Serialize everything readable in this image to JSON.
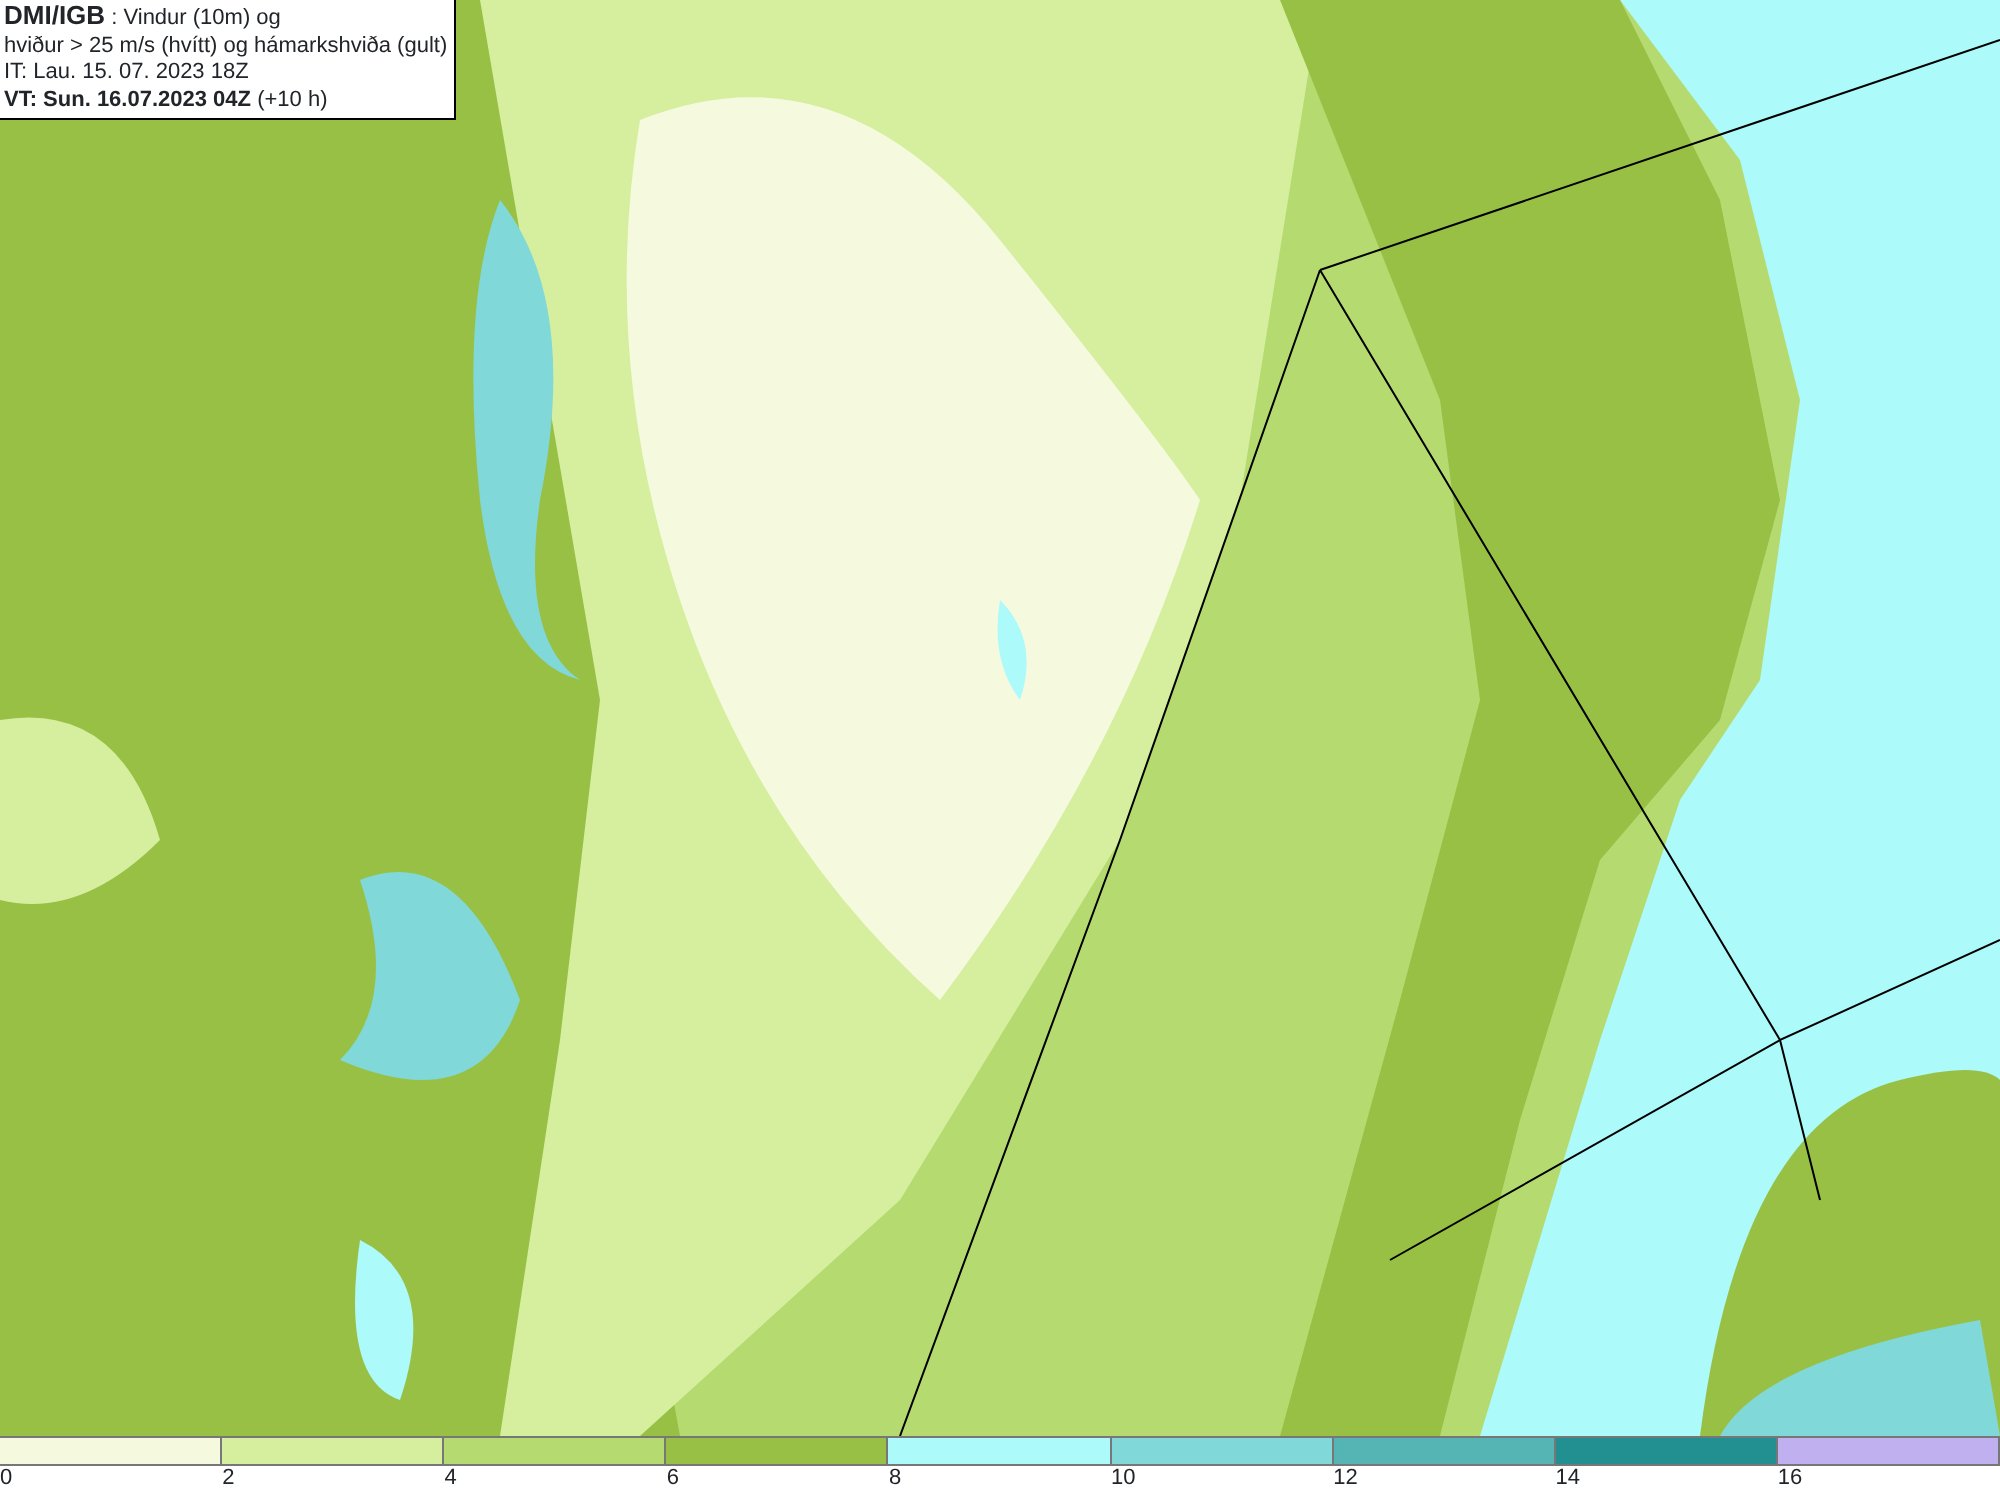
{
  "title_box": {
    "lines": [
      "**DMI/IGB** : Vindur (10m) og",
      "hviður > 25 m/s (hvítt) og hámarkshviða (gult)",
      "IT: Lau. 15. 07. 2023 18Z",
      "**VT: Sun. 16.07.2023 04Z** (+10 h)"
    ]
  },
  "legend": {
    "bins": [
      {
        "color": "#f5fadf"
      },
      {
        "color": "#d5ef9f"
      },
      {
        "color": "#b5db70"
      },
      {
        "color": "#98c045"
      },
      {
        "color": "#adfafa"
      },
      {
        "color": "#80d8d8"
      },
      {
        "color": "#55b4b4"
      },
      {
        "color": "#229090"
      },
      {
        "color": "#c0b0f0"
      }
    ],
    "ticks": [
      "0",
      "2",
      "4",
      "6",
      "8",
      "10",
      "12",
      "14",
      "16"
    ]
  }
}
